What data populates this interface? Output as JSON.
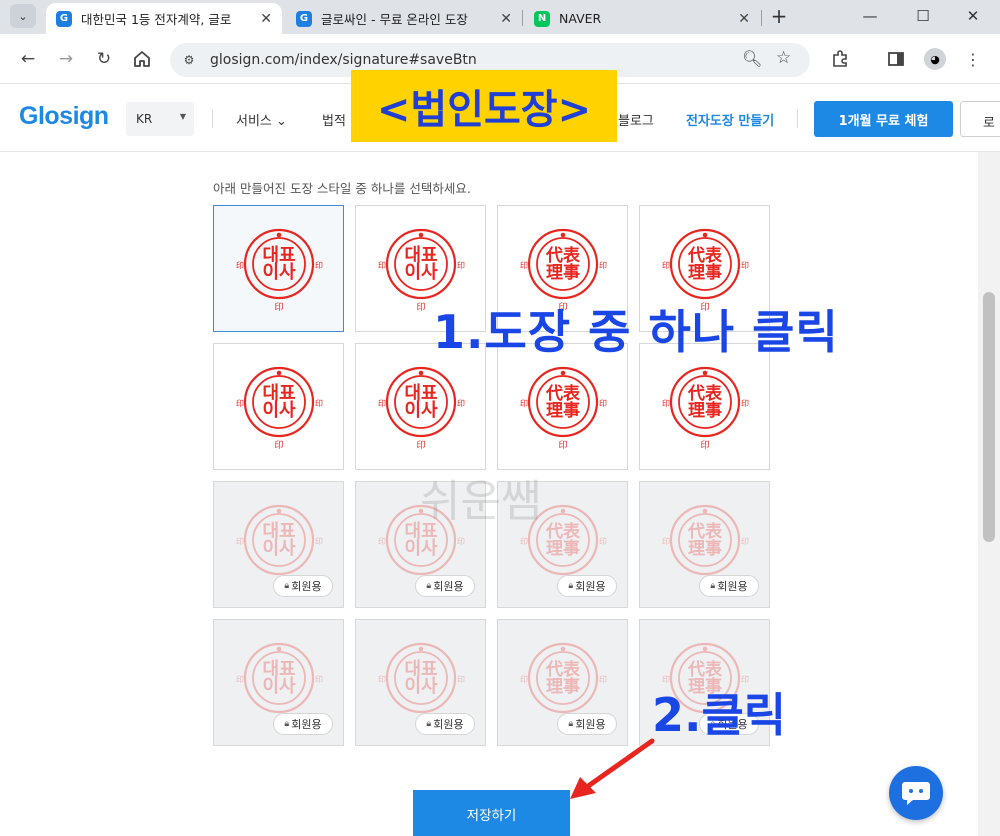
{
  "browser": {
    "tabs": [
      {
        "title": "대한민국 1등 전자계약, 글로",
        "close": "✕",
        "favicon": "G"
      },
      {
        "title": "글로싸인 - 무료 온라인 도장",
        "close": "✕",
        "favicon": "G"
      },
      {
        "title": "NAVER",
        "close": "✕",
        "favicon": "N"
      }
    ],
    "new_tab": "+",
    "url": "glosign.com/index/signature#saveBtn"
  },
  "header": {
    "logo": "Glosign",
    "lang": "KR",
    "nav": [
      "서비스 ⌄",
      "법적",
      "블로그",
      "전자도장 만들기"
    ],
    "trial_button": "1개월 무료 체험",
    "login_button": "로"
  },
  "main": {
    "instruction": "아래 만들어진 도장 스타일 중 하나를 선택하세요.",
    "member_badge": "회원용",
    "save_button": "저장하기",
    "stamps": {
      "side_char": "印",
      "bottom_char": "印",
      "styles": [
        {
          "lines": [
            "대표",
            "이사"
          ],
          "cjk": false
        },
        {
          "lines": [
            "대표",
            "이사"
          ],
          "cjk": false
        },
        {
          "lines": [
            "代表",
            "理事"
          ],
          "cjk": true
        },
        {
          "lines": [
            "代表",
            "理事"
          ],
          "cjk": true
        }
      ]
    }
  },
  "overlay": {
    "title": "<법인도장>",
    "step1": "1.도장 중 하나 클릭",
    "step2": "2.클릭",
    "watermark": "쉬운쌤"
  },
  "colors": {
    "brand_blue": "#1e88e5",
    "stamp_red": "#e8261f",
    "annotation_blue": "#1a46e6",
    "highlight_yellow": "#ffd200"
  },
  "icons": {
    "back": "arrow-left-icon",
    "forward": "arrow-right-icon",
    "reload": "reload-icon",
    "home": "home-icon",
    "site_info": "tune-icon",
    "zoom": "zoom-icon",
    "bookmark": "star-icon",
    "extensions": "puzzle-icon",
    "side_panel": "side-panel-icon",
    "menu": "kebab-menu-icon",
    "chat": "chat-bubble-icon",
    "lock": "lock-icon"
  }
}
